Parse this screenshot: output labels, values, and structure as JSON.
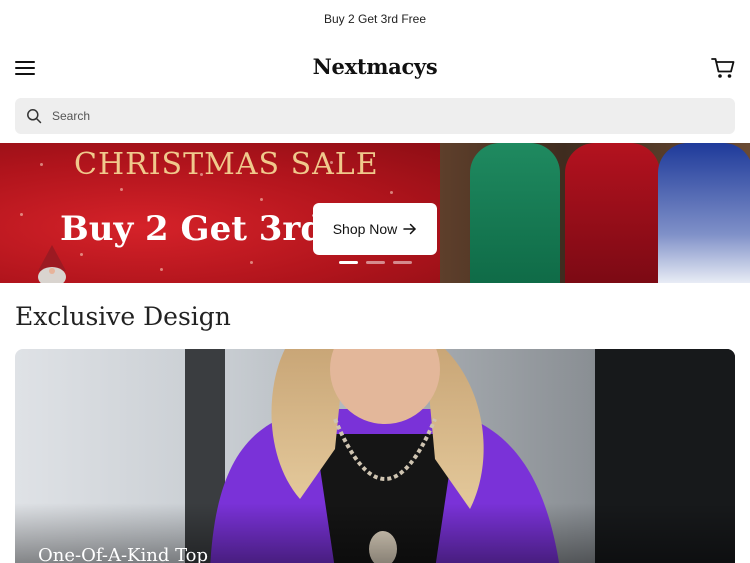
{
  "promo": {
    "text": "Buy 2 Get 3rd Free"
  },
  "header": {
    "logo": "Nextmacys",
    "menu_icon": "hamburger-menu-icon",
    "cart_icon": "shopping-cart-icon"
  },
  "search": {
    "placeholder": "Search",
    "value": "",
    "icon": "search-icon"
  },
  "hero": {
    "sale_text": "CHRISTMAS SALE",
    "headline": "Buy 2 Get 3rd Free",
    "cta_label": "Shop Now",
    "cta_icon": "arrow-right-icon",
    "slides_total": 3,
    "active_slide": 1,
    "colors": {
      "background": "#b5141d",
      "gold": "#f0c98c"
    }
  },
  "section": {
    "title": "Exclusive Design"
  },
  "product": {
    "caption": "One-Of-A-Kind Top",
    "accent": "#7a32d8"
  }
}
